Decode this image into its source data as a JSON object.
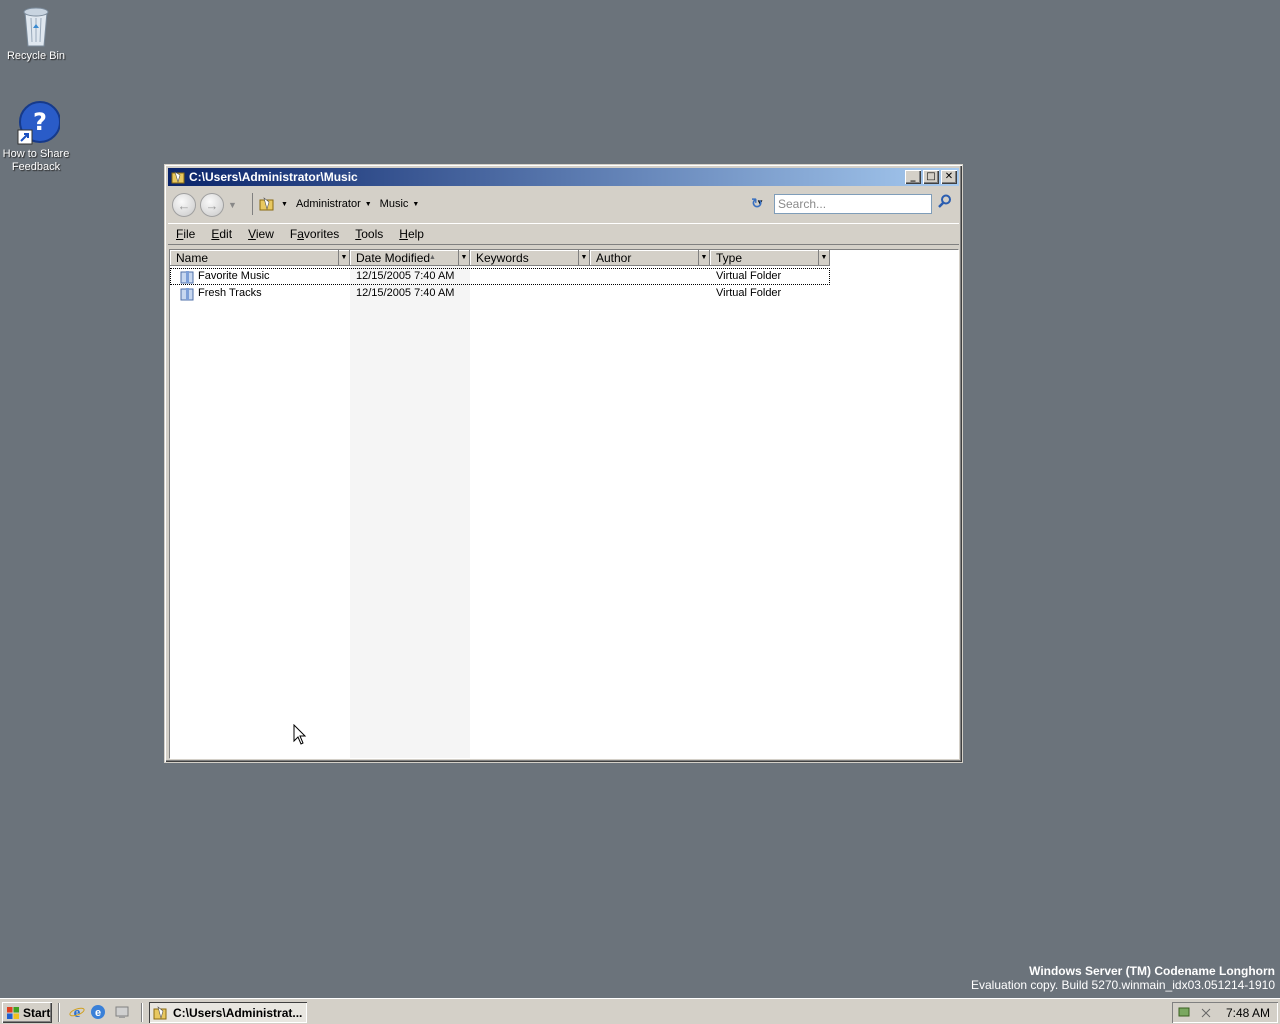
{
  "desktop": {
    "icons": [
      {
        "label": "Recycle Bin"
      },
      {
        "label": "How to Share Feedback"
      }
    ],
    "watermark": {
      "line1": "Windows Server (TM) Codename Longhorn",
      "line2": "Evaluation copy. Build 5270.winmain_idx03.051214-1910"
    }
  },
  "window": {
    "title": "C:\\Users\\Administrator\\Music",
    "controls": {
      "minimize": "_",
      "maximize": "□",
      "close": "✕"
    },
    "breadcrumbs": [
      "Administrator",
      "Music"
    ],
    "search": {
      "placeholder": "Search..."
    },
    "menu": [
      {
        "accel": "F",
        "rest": "ile"
      },
      {
        "accel": "E",
        "rest": "dit"
      },
      {
        "accel": "V",
        "rest": "iew"
      },
      {
        "accel": "",
        "pre": "F",
        "accel2": "a",
        "rest": "vorites"
      },
      {
        "accel": "T",
        "rest": "ools"
      },
      {
        "accel": "H",
        "rest": "elp"
      }
    ],
    "columns": [
      "Name",
      "Date Modified",
      "Keywords",
      "Author",
      "Type"
    ],
    "rows": [
      {
        "name": "Favorite Music",
        "date": "12/15/2005 7:40 AM",
        "keywords": "",
        "author": "",
        "type": "Virtual Folder"
      },
      {
        "name": "Fresh Tracks",
        "date": "12/15/2005 7:40 AM",
        "keywords": "",
        "author": "",
        "type": "Virtual Folder"
      }
    ]
  },
  "taskbar": {
    "start_label": "Start",
    "task_label": "C:\\Users\\Administrat...",
    "clock": "7:48 AM"
  },
  "colors": {
    "desktop": "#6b737b",
    "titlebar_start": "#0a246a",
    "titlebar_end": "#a6caf0"
  }
}
